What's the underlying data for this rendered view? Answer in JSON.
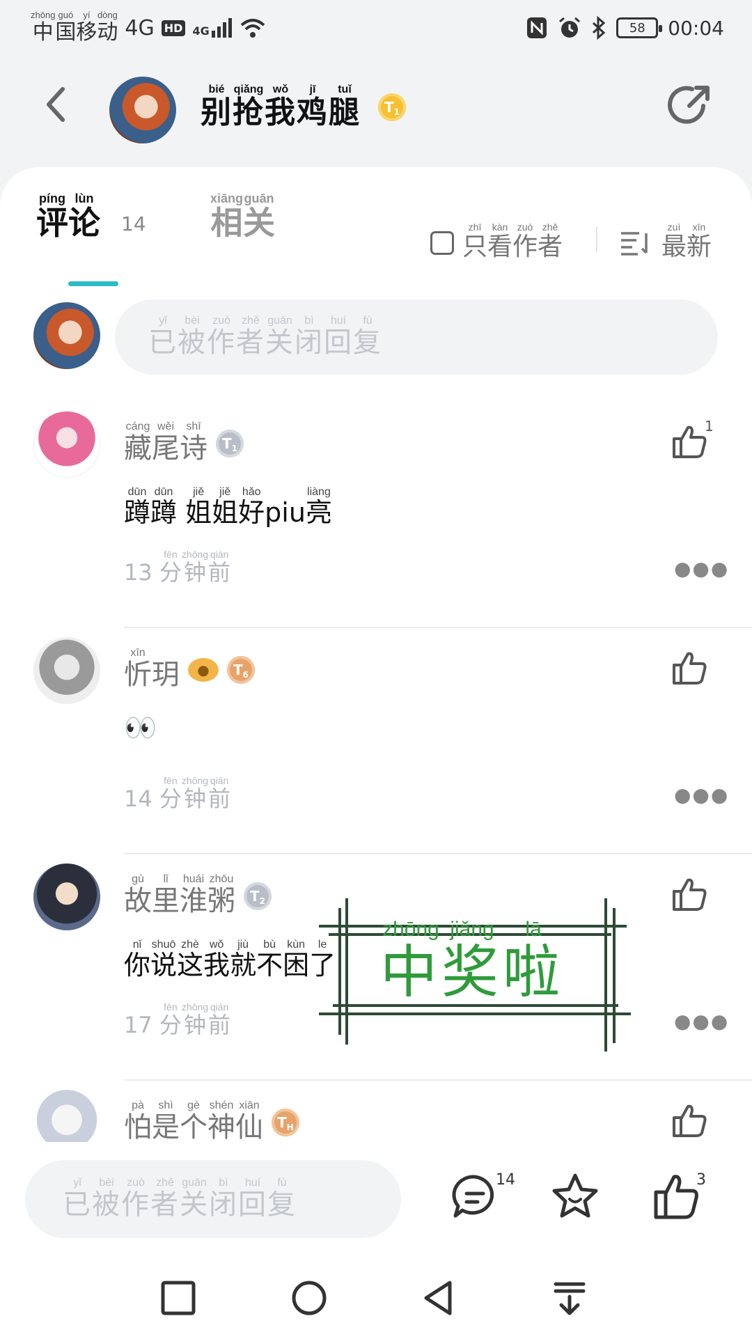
{
  "status_bar": {
    "carrier": [
      [
        "中",
        "zhōng"
      ],
      [
        "国",
        "guó"
      ],
      [
        "移",
        "yí"
      ],
      [
        "动",
        "dòng"
      ]
    ],
    "network": "4G",
    "hd_badge": "HD",
    "signal_label": "4G",
    "battery": "58",
    "time": "00:04"
  },
  "header": {
    "title": [
      [
        "别",
        "bié"
      ],
      [
        "抢",
        "qiǎng"
      ],
      [
        "我",
        "wǒ"
      ],
      [
        "鸡",
        "jī"
      ],
      [
        "腿",
        "tuǐ"
      ]
    ],
    "level_badge": "T",
    "level_sub": "1"
  },
  "tabs": {
    "comments": [
      [
        "评",
        "píng"
      ],
      [
        "论",
        "lùn"
      ]
    ],
    "comments_count": "14",
    "related": [
      [
        "相",
        "xiāng"
      ],
      [
        "关",
        "guān"
      ]
    ],
    "author_only": [
      [
        "只",
        "zhī"
      ],
      [
        "看",
        "kàn"
      ],
      [
        "作",
        "zuò"
      ],
      [
        "者",
        "zhě"
      ]
    ],
    "sort": [
      [
        "最",
        "zuì"
      ],
      [
        "新",
        "xīn"
      ]
    ]
  },
  "reply_input": {
    "placeholder": [
      [
        "已",
        "yǐ"
      ],
      [
        "被",
        "bèi"
      ],
      [
        "作",
        "zuò"
      ],
      [
        "者",
        "zhě"
      ],
      [
        "关",
        "guān"
      ],
      [
        "闭",
        "bì"
      ],
      [
        "回",
        "huí"
      ],
      [
        "复",
        "fù"
      ]
    ]
  },
  "comments": [
    {
      "name": [
        [
          "藏",
          "cáng"
        ],
        [
          "尾",
          "wěi"
        ],
        [
          "诗",
          "shī"
        ]
      ],
      "badge": "T",
      "badge_sub": "1",
      "badge_color": "#b8bec8",
      "text": [
        [
          "蹲",
          "dūn"
        ],
        [
          "蹲",
          "dūn"
        ],
        [
          " ",
          ""
        ],
        [
          "姐",
          "jiě"
        ],
        [
          "姐",
          "jiě"
        ],
        [
          "好",
          "hǎo"
        ],
        [
          "piu",
          ""
        ],
        [
          "亮",
          "liàng"
        ]
      ],
      "time_num": "13",
      "time_suffix": [
        [
          "分",
          "fēn"
        ],
        [
          "钟",
          "zhōng"
        ],
        [
          "前",
          "qián"
        ]
      ],
      "likes": "1"
    },
    {
      "name": [
        [
          "忻",
          "xīn"
        ],
        [
          "玥",
          ""
        ]
      ],
      "badge": "T",
      "badge_sub": "6",
      "badge_color": "#e8a36a",
      "text": [
        [
          "👀",
          ""
        ]
      ],
      "time_num": "14",
      "time_suffix": [
        [
          "分",
          "fēn"
        ],
        [
          "钟",
          "zhōng"
        ],
        [
          "前",
          "qián"
        ]
      ],
      "likes": ""
    },
    {
      "name": [
        [
          "故",
          "gù"
        ],
        [
          "里",
          "lǐ"
        ],
        [
          "淮",
          "huái"
        ],
        [
          "粥",
          "zhōu"
        ]
      ],
      "badge": "T",
      "badge_sub": "2",
      "badge_color": "#b8bec8",
      "text": [
        [
          "你",
          "nǐ"
        ],
        [
          "说",
          "shuō"
        ],
        [
          "这",
          "zhè"
        ],
        [
          "我",
          "wǒ"
        ],
        [
          "就",
          "jiù"
        ],
        [
          "不",
          "bù"
        ],
        [
          "困",
          "kùn"
        ],
        [
          "了",
          "le"
        ]
      ],
      "time_num": "17",
      "time_suffix": [
        [
          "分",
          "fēn"
        ],
        [
          "钟",
          "zhōng"
        ],
        [
          "前",
          "qián"
        ]
      ],
      "likes": ""
    },
    {
      "name": [
        [
          "怕",
          "pà"
        ],
        [
          "是",
          "shì"
        ],
        [
          "个",
          "gè"
        ],
        [
          "神",
          "shén"
        ],
        [
          "仙",
          "xiān"
        ]
      ],
      "badge": "T",
      "badge_sub": "H",
      "badge_color": "#e8a36a",
      "text": [],
      "time_num": "",
      "time_suffix": [],
      "likes": ""
    }
  ],
  "stamp": {
    "text": [
      [
        "中",
        "zhōng"
      ],
      [
        "奖",
        "jiǎng"
      ],
      [
        "啦",
        "lā"
      ]
    ],
    "color": "#2f9b3b"
  },
  "bottom_bar": {
    "placeholder": [
      [
        "已",
        "yǐ"
      ],
      [
        "被",
        "bèi"
      ],
      [
        "作",
        "zuò"
      ],
      [
        "者",
        "zhě"
      ],
      [
        "关",
        "guān"
      ],
      [
        "闭",
        "bì"
      ],
      [
        "回",
        "huí"
      ],
      [
        "复",
        "fù"
      ]
    ],
    "comment_count": "14",
    "like_count": "3"
  },
  "colors": {
    "accent": "#2bbcc6",
    "stamp_green": "#2f9b3b",
    "stamp_frame": "#2d4a35"
  },
  "icons": {
    "back": "chevron-left-icon",
    "share": "share-icon",
    "like": "thumb-up-icon",
    "more": "more-icon",
    "comment": "comment-icon",
    "favorite": "star-icon",
    "sort": "sort-icon"
  }
}
